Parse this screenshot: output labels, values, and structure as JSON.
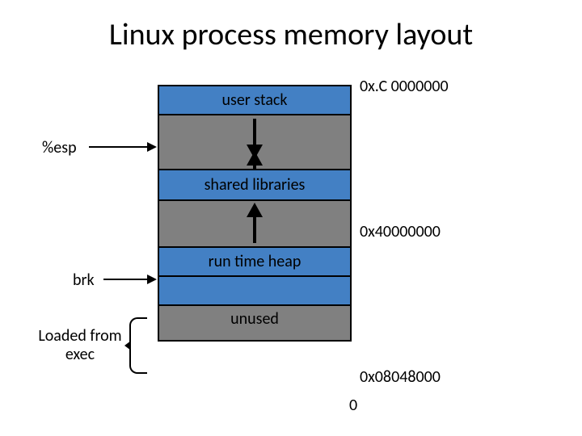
{
  "title": "Linux process memory layout",
  "segments": {
    "user_stack": "user stack",
    "shared_libs": "shared libraries",
    "runtime_heap": "run time heap",
    "loaded_exec": "",
    "unused": "unused"
  },
  "pointers": {
    "esp": "%esp",
    "brk": "brk",
    "loaded_from_exec": "Loaded from exec"
  },
  "addresses": {
    "top": "0x.C 0000000",
    "shared": "0x40000000",
    "exec_base": "0x08048000",
    "zero": "0"
  }
}
